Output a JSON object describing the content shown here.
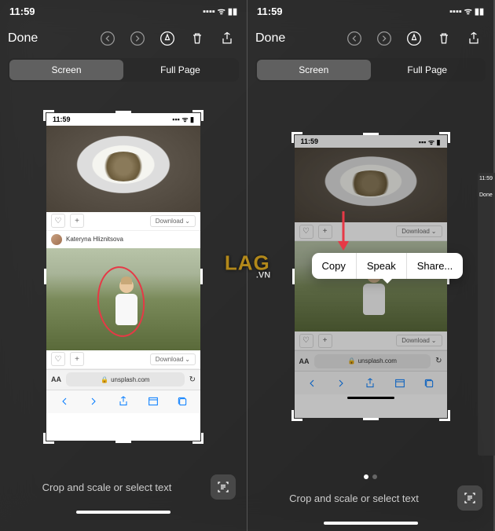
{
  "status": {
    "time": "11:59",
    "signal": "▪▪▪▪",
    "wifi": "◉",
    "battery": "▮▮"
  },
  "toolbar": {
    "done": "Done"
  },
  "tabs": {
    "screen": "Screen",
    "fullpage": "Full Page"
  },
  "screenshot": {
    "time": "11:59",
    "download": "Download",
    "author": "Kateryna Hliznitsova",
    "aa": "AA",
    "lock": "🔒",
    "url": "unsplash.com",
    "refresh": "↻"
  },
  "context": {
    "copy": "Copy",
    "speak": "Speak",
    "share": "Share..."
  },
  "hint": "Crop and scale or select text",
  "watermark": {
    "main": "LAG",
    "sub": ".VN"
  },
  "side": {
    "label": "Done"
  }
}
